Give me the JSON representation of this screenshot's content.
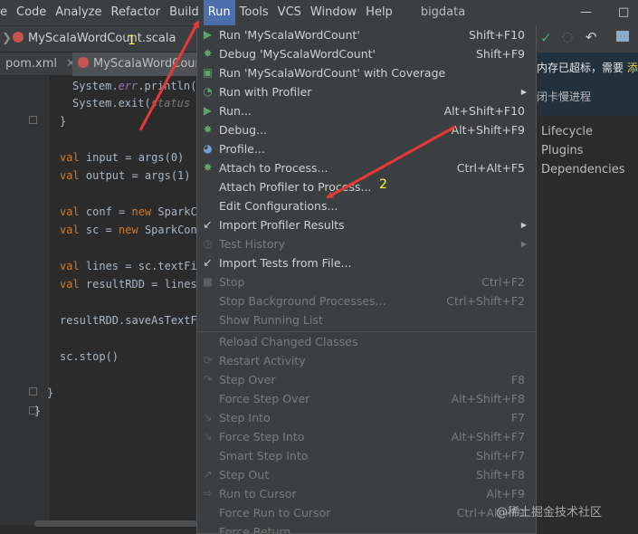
{
  "menubar": {
    "items": [
      "e",
      "Code",
      "Analyze",
      "Refactor",
      "Build",
      "Run",
      "Tools",
      "VCS",
      "Window",
      "Help"
    ],
    "active": "Run",
    "project_title": "bigdata"
  },
  "navbar": {
    "file_crumb": "MyScalaWordCount.scala"
  },
  "tabs": {
    "pom": "pom.xml",
    "scala": "MyScalaWordCoun"
  },
  "code_lines": {
    "l1a": "System.",
    "l1b": "err",
    "l1c": ".println()",
    "l2a": "System.exit(",
    "l2b": "status =",
    "l3": "}",
    "l4a": "val",
    "l4b": " input = args(0)",
    "l5a": "val",
    "l5b": " output = args(1)",
    "l6a": "val",
    "l6b": " conf = ",
    "l6c": "new",
    "l6d": " SparkCo",
    "l7a": "val",
    "l7b": " sc = ",
    "l7c": "new",
    "l7d": " SparkCont",
    "l8a": "val",
    "l8b": " lines = sc.textFil",
    "l9a": "val",
    "l9b": " resultRDD = lines.",
    "l10": "resultRDD.saveAsTextFi",
    "l11": "sc.stop()",
    "l12": "}",
    "l13": "}"
  },
  "notification": {
    "line1a": "内存已超标，需要",
    "line1b": "添",
    "line2": "闭卡慢进程"
  },
  "maven": [
    "Lifecycle",
    "Plugins",
    "Dependencies"
  ],
  "run_menu": {
    "run": {
      "label": "Run 'MyScalaWordCount'",
      "shortcut": "Shift+F10"
    },
    "debug": {
      "label": "Debug 'MyScalaWordCount'",
      "shortcut": "Shift+F9"
    },
    "coverage": {
      "label": "Run 'MyScalaWordCount' with Coverage"
    },
    "profiler": {
      "label": "Run with Profiler"
    },
    "run_dots": {
      "label": "Run...",
      "shortcut": "Alt+Shift+F10"
    },
    "debug_dots": {
      "label": "Debug...",
      "shortcut": "Alt+Shift+F9"
    },
    "profile": {
      "label": "Profile..."
    },
    "attach": {
      "label": "Attach to Process...",
      "shortcut": "Ctrl+Alt+F5"
    },
    "attach_profiler": {
      "label": "Attach Profiler to Process..."
    },
    "edit_config": {
      "label": "Edit Configurations..."
    },
    "import_profiler": {
      "label": "Import Profiler Results"
    },
    "test_history": {
      "label": "Test History"
    },
    "import_tests": {
      "label": "Import Tests from File..."
    },
    "stop": {
      "label": "Stop",
      "shortcut": "Ctrl+F2"
    },
    "stop_bg": {
      "label": "Stop Background Processes...",
      "shortcut": "Ctrl+Shift+F2"
    },
    "show_running": {
      "label": "Show Running List"
    },
    "reload": {
      "label": "Reload Changed Classes"
    },
    "restart": {
      "label": "Restart Activity"
    },
    "step_over": {
      "label": "Step Over",
      "shortcut": "F8"
    },
    "force_step_over": {
      "label": "Force Step Over",
      "shortcut": "Alt+Shift+F8"
    },
    "step_into": {
      "label": "Step Into",
      "shortcut": "F7"
    },
    "force_step_into": {
      "label": "Force Step Into",
      "shortcut": "Alt+Shift+F7"
    },
    "smart_step_into": {
      "label": "Smart Step Into",
      "shortcut": "Shift+F7"
    },
    "step_out": {
      "label": "Step Out",
      "shortcut": "Shift+F8"
    },
    "run_to_cursor": {
      "label": "Run to Cursor",
      "shortcut": "Alt+F9"
    },
    "force_run_to_cursor": {
      "label": "Force Run to Cursor",
      "shortcut": "Ctrl+Alt+F9"
    },
    "force_return": {
      "label": "Force Return"
    }
  },
  "annotations": {
    "marker1": "1",
    "marker2": "2",
    "arrow_color": "#e53935"
  },
  "watermark": "@稀土掘金技术社区",
  "colors": {
    "menu_bg": "#3c3f41",
    "active_menu": "#4b6eaf",
    "run_green": "#59a869",
    "keyword": "#cc7832"
  }
}
